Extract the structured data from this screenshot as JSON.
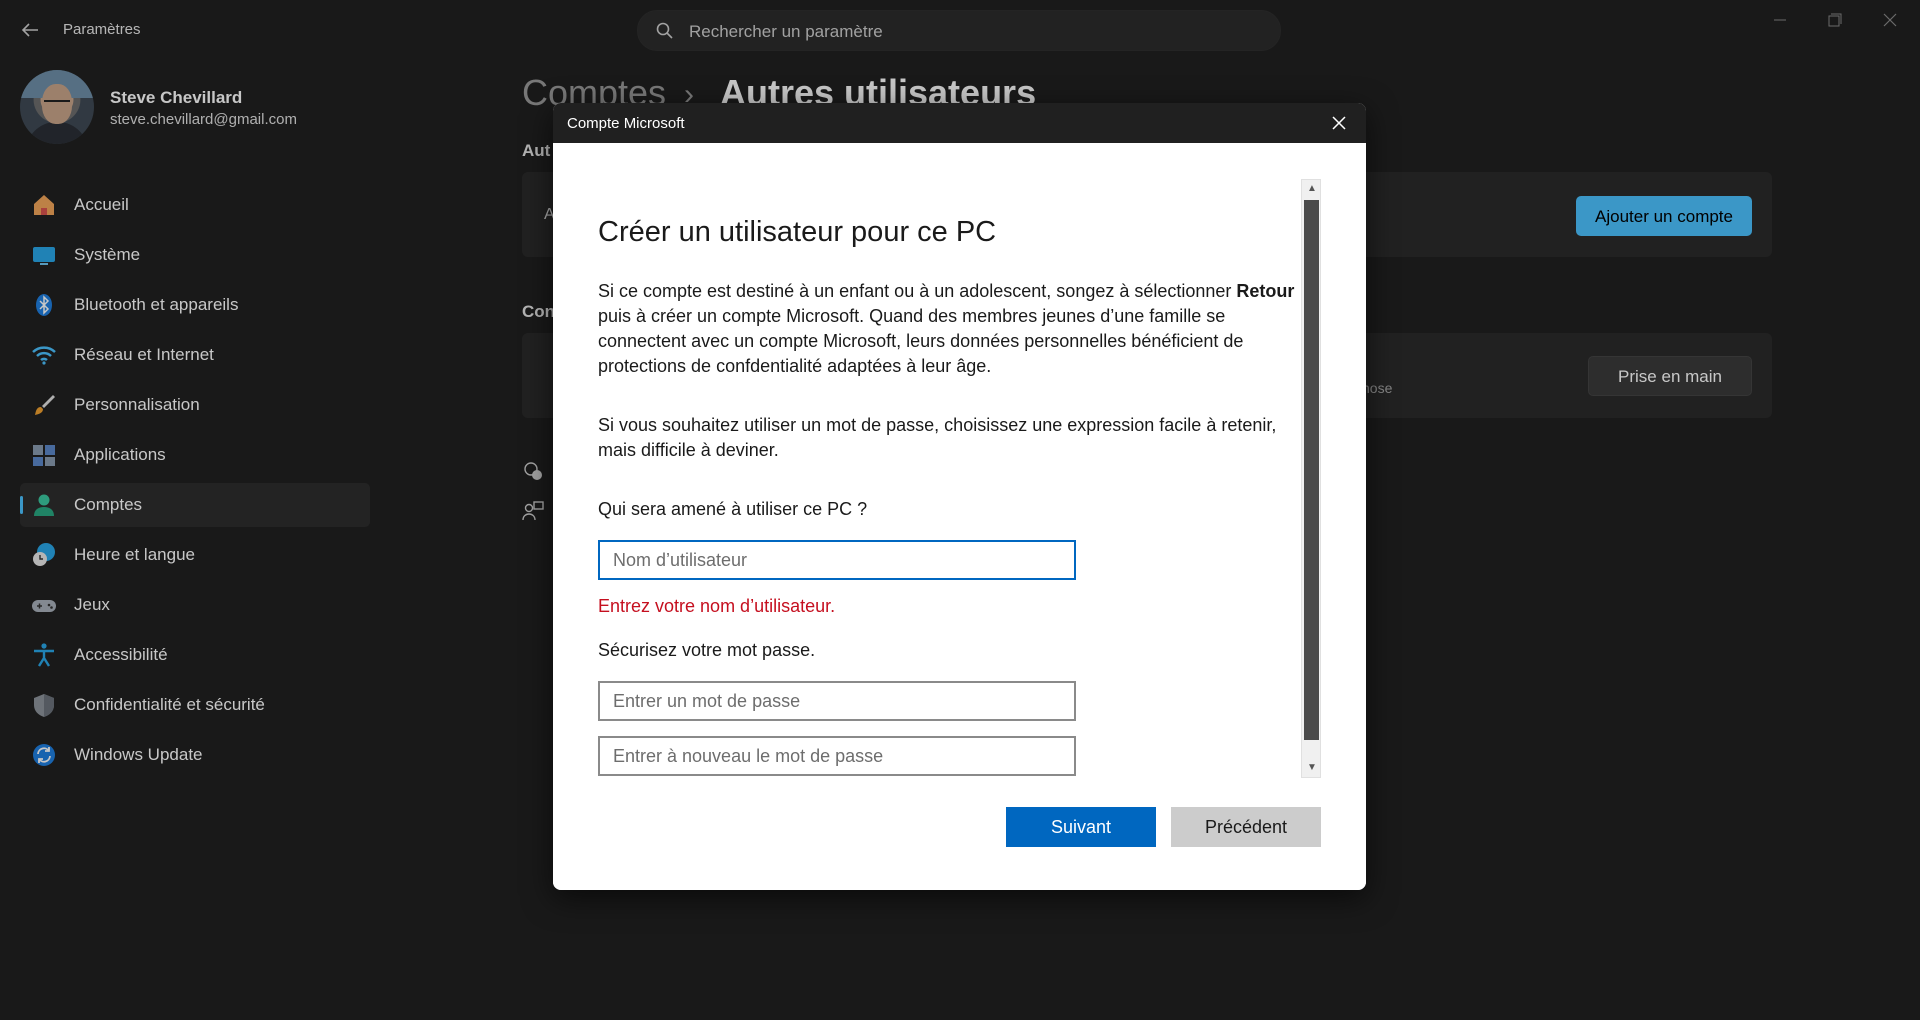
{
  "app": {
    "title": "Paramètres"
  },
  "search": {
    "placeholder": "Rechercher un paramètre"
  },
  "profile": {
    "name": "Steve Chevillard",
    "email": "steve.chevillard@gmail.com"
  },
  "nav": {
    "items": [
      {
        "label": "Accueil",
        "icon": "home-icon"
      },
      {
        "label": "Système",
        "icon": "system-icon"
      },
      {
        "label": "Bluetooth et appareils",
        "icon": "bluetooth-icon"
      },
      {
        "label": "Réseau et Internet",
        "icon": "wifi-icon"
      },
      {
        "label": "Personnalisation",
        "icon": "brush-icon"
      },
      {
        "label": "Applications",
        "icon": "apps-icon"
      },
      {
        "label": "Comptes",
        "icon": "accounts-icon",
        "active": true
      },
      {
        "label": "Heure et langue",
        "icon": "time-language-icon"
      },
      {
        "label": "Jeux",
        "icon": "gamepad-icon"
      },
      {
        "label": "Accessibilité",
        "icon": "accessibility-icon"
      },
      {
        "label": "Confidentialité et sécurité",
        "icon": "shield-icon"
      },
      {
        "label": "Windows Update",
        "icon": "update-icon"
      }
    ]
  },
  "background": {
    "breadcrumb_parent": "Comptes",
    "breadcrumb_sep": "›",
    "breadcrumb_current": "Autres utilisateurs",
    "section1_label": "Aut",
    "card1_text": "A",
    "add_account_button": "Ajouter un compte",
    "section2_label": "Con",
    "card2_sub": "hose",
    "start_button": "Prise en main"
  },
  "dialog": {
    "title": "Compte Microsoft",
    "heading": "Créer un utilisateur pour ce PC",
    "para1_line1_a": "Si ce compte est destiné à un enfant ou à un adolescent, songez à sélectionner ",
    "para1_line1_b": "Retour",
    "para1_line2": "puis à créer un compte Microsoft. Quand des membres jeunes d’une famille se",
    "para1_line3": "connectent avec un compte Microsoft, leurs données personnelles bénéficient de",
    "para1_line4": "protections de confdentialité adaptées à leur âge.",
    "para2_line1": "Si vous souhaitez utiliser un mot de passe, choisissez une expression facile à retenir,",
    "para2_line2": "mais difficile à deviner.",
    "username_label": "Qui sera amené à utiliser ce PC ?",
    "username_placeholder": "Nom d’utilisateur",
    "username_error": "Entrez votre nom d’utilisateur.",
    "password_label": "Sécurisez votre mot passe.",
    "password_placeholder": "Entrer un mot de passe",
    "password_confirm_placeholder": "Entrer à nouveau le mot de passe",
    "next_button": "Suivant",
    "previous_button": "Précédent"
  },
  "colors": {
    "accent": "#4cc2ff",
    "primary_button": "#0067c0",
    "error": "#c50f1f"
  }
}
